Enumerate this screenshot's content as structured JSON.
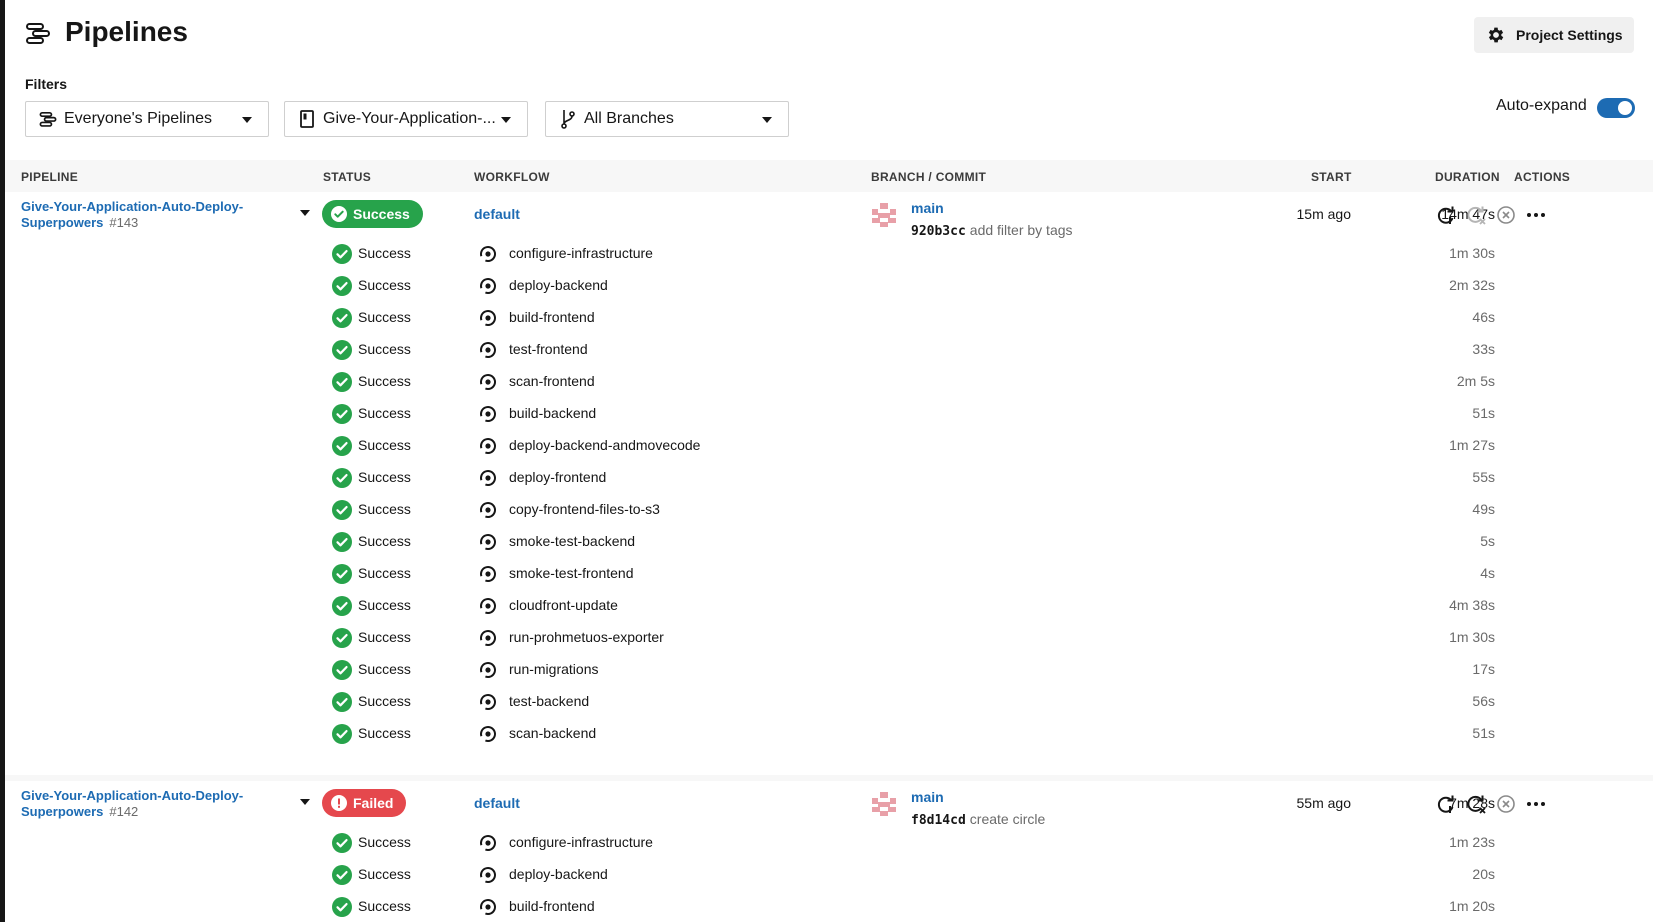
{
  "header": {
    "title": "Pipelines",
    "project_settings_label": "Project Settings"
  },
  "filters": {
    "label": "Filters",
    "pipelines_filter": "Everyone's Pipelines",
    "project_filter": "Give-Your-Application-...",
    "branch_filter": "All Branches",
    "auto_expand_label": "Auto-expand",
    "auto_expand_on": true
  },
  "table": {
    "columns": [
      "PIPELINE",
      "STATUS",
      "WORKFLOW",
      "BRANCH / COMMIT",
      "START",
      "DURATION",
      "ACTIONS"
    ]
  },
  "colors": {
    "link": "#1d6bb3",
    "success": "#27a34b",
    "failed": "#e5484d"
  },
  "pipelines": [
    {
      "name": "Give-Your-Application-Auto-Deploy-Superpowers",
      "number": "#143",
      "status": "Success",
      "workflow": "default",
      "branch": "main",
      "commit_sha": "920b3cc",
      "commit_message": "add filter by tags",
      "start": "15m ago",
      "duration": "14m 47s",
      "jobs": [
        {
          "status": "Success",
          "name": "configure-infrastructure",
          "duration": "1m 30s"
        },
        {
          "status": "Success",
          "name": "deploy-backend",
          "duration": "2m 32s"
        },
        {
          "status": "Success",
          "name": "build-frontend",
          "duration": "46s"
        },
        {
          "status": "Success",
          "name": "test-frontend",
          "duration": "33s"
        },
        {
          "status": "Success",
          "name": "scan-frontend",
          "duration": "2m 5s"
        },
        {
          "status": "Success",
          "name": "build-backend",
          "duration": "51s"
        },
        {
          "status": "Success",
          "name": "deploy-backend-andmovecode",
          "duration": "1m 27s"
        },
        {
          "status": "Success",
          "name": "deploy-frontend",
          "duration": "55s"
        },
        {
          "status": "Success",
          "name": "copy-frontend-files-to-s3",
          "duration": "49s"
        },
        {
          "status": "Success",
          "name": "smoke-test-backend",
          "duration": "5s"
        },
        {
          "status": "Success",
          "name": "smoke-test-frontend",
          "duration": "4s"
        },
        {
          "status": "Success",
          "name": "cloudfront-update",
          "duration": "4m 38s"
        },
        {
          "status": "Success",
          "name": "run-prohmetuos-exporter",
          "duration": "1m 30s"
        },
        {
          "status": "Success",
          "name": "run-migrations",
          "duration": "17s"
        },
        {
          "status": "Success",
          "name": "test-backend",
          "duration": "56s"
        },
        {
          "status": "Success",
          "name": "scan-backend",
          "duration": "51s"
        }
      ]
    },
    {
      "name": "Give-Your-Application-Auto-Deploy-Superpowers",
      "number": "#142",
      "status": "Failed",
      "workflow": "default",
      "branch": "main",
      "commit_sha": "f8d14cd",
      "commit_message": "create circle",
      "start": "55m ago",
      "duration": "7m 28s",
      "jobs": [
        {
          "status": "Success",
          "name": "configure-infrastructure",
          "duration": "1m 23s"
        },
        {
          "status": "Success",
          "name": "deploy-backend",
          "duration": "20s"
        },
        {
          "status": "Success",
          "name": "build-frontend",
          "duration": "1m 20s"
        }
      ]
    }
  ]
}
